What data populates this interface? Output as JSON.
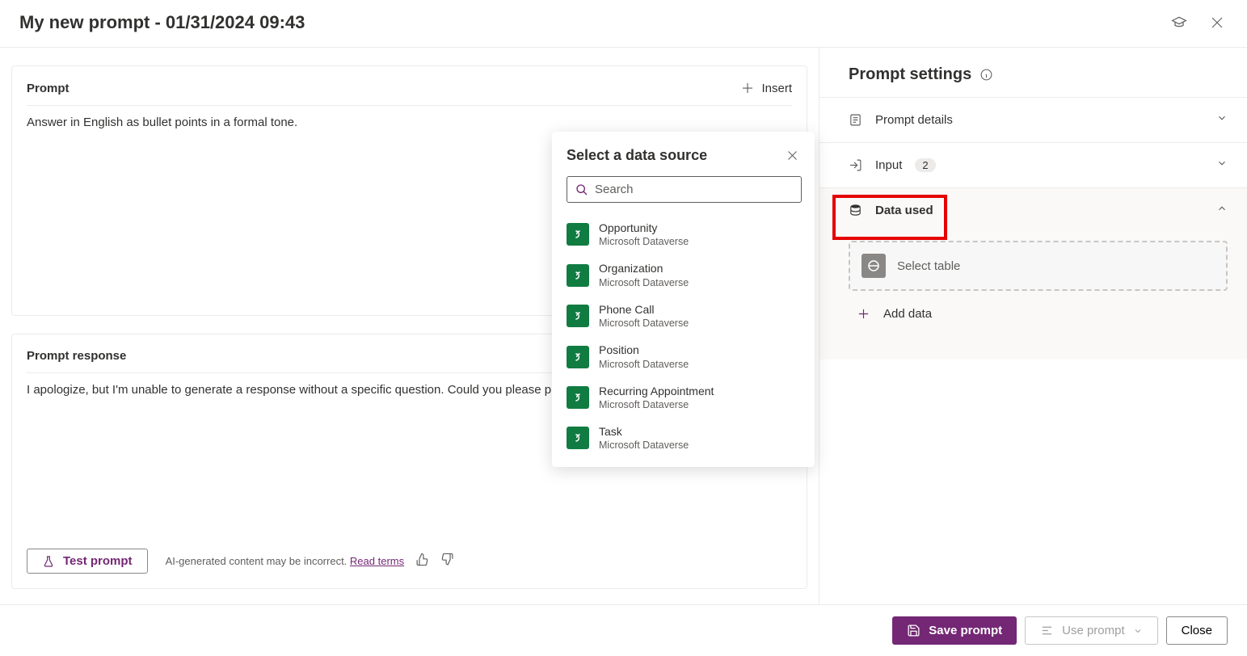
{
  "header": {
    "title": "My new prompt - 01/31/2024 09:43"
  },
  "prompt_card": {
    "title": "Prompt",
    "insert_label": "Insert",
    "body": "Answer in English as bullet points in a formal tone."
  },
  "response_card": {
    "title": "Prompt response",
    "body": "I apologize, but I'm unable to generate a response without a specific question. Could you please provide",
    "test_label": "Test prompt",
    "disclaimer": "AI-generated content may be incorrect.",
    "read_terms": "Read terms"
  },
  "sidebar": {
    "title": "Prompt settings",
    "prompt_details": "Prompt details",
    "input_label": "Input",
    "input_count": "2",
    "data_used": "Data used",
    "select_table": "Select table",
    "add_data": "Add data"
  },
  "popup": {
    "title": "Select a data source",
    "search_placeholder": "Search",
    "items": [
      {
        "name": "Opportunity",
        "sub": "Microsoft Dataverse"
      },
      {
        "name": "Organization",
        "sub": "Microsoft Dataverse"
      },
      {
        "name": "Phone Call",
        "sub": "Microsoft Dataverse"
      },
      {
        "name": "Position",
        "sub": "Microsoft Dataverse"
      },
      {
        "name": "Recurring Appointment",
        "sub": "Microsoft Dataverse"
      },
      {
        "name": "Task",
        "sub": "Microsoft Dataverse"
      }
    ]
  },
  "footer": {
    "save": "Save prompt",
    "use": "Use prompt",
    "close": "Close"
  }
}
